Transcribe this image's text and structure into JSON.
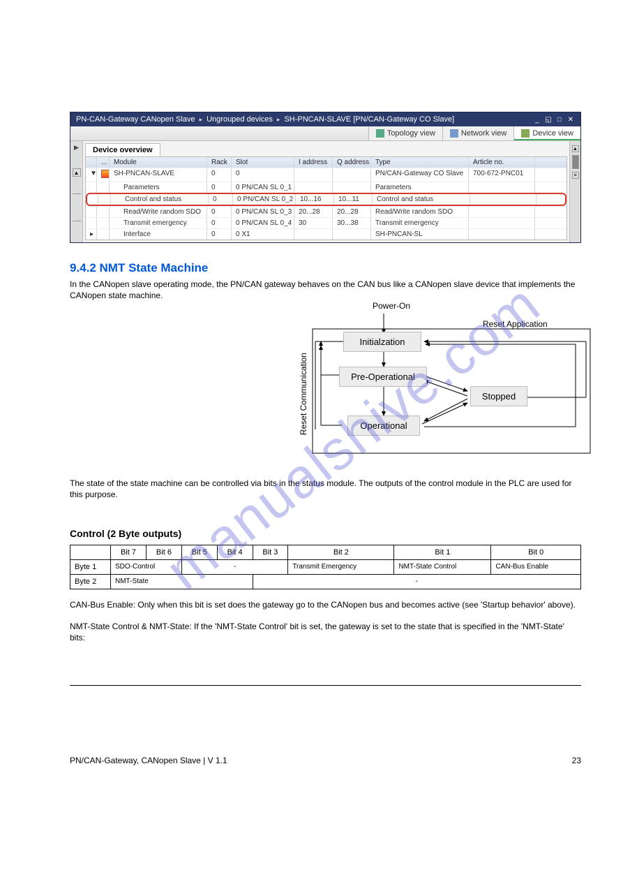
{
  "tia": {
    "breadcrumb": [
      "PN-CAN-Gateway CANopen Slave",
      "Ungrouped devices",
      "SH-PNCAN-SLAVE [PN/CAN-Gateway CO Slave]"
    ],
    "views": {
      "topology": "Topology view",
      "network": "Network view",
      "device": "Device view"
    },
    "overview_tab": "Device overview",
    "headers": {
      "module": "Module",
      "rack": "Rack",
      "slot": "Slot",
      "iaddr": "I address",
      "qaddr": "Q address",
      "type": "Type",
      "article": "Article no."
    },
    "rows": [
      {
        "indent": 0,
        "exp": "▼",
        "icon": true,
        "module": "SH-PNCAN-SLAVE",
        "rack": "0",
        "slot": "0",
        "iaddr": "",
        "qaddr": "",
        "type": "PN/CAN-Gateway CO Slave",
        "article": "700-672-PNC01",
        "hl": false
      },
      {
        "indent": 1,
        "exp": "",
        "icon": false,
        "module": "Parameters",
        "rack": "0",
        "slot": "0 PN/CAN SL 0_1",
        "iaddr": "",
        "qaddr": "",
        "type": "Parameters",
        "article": "",
        "hl": false
      },
      {
        "indent": 1,
        "exp": "",
        "icon": false,
        "module": "Control and status",
        "rack": "0",
        "slot": "0 PN/CAN SL 0_2",
        "iaddr": "10...16",
        "qaddr": "10...11",
        "type": "Control and status",
        "article": "",
        "hl": true
      },
      {
        "indent": 1,
        "exp": "",
        "icon": false,
        "module": "Read/Write random SDO",
        "rack": "0",
        "slot": "0 PN/CAN SL 0_3",
        "iaddr": "20...28",
        "qaddr": "20...28",
        "type": "Read/Write random SDO",
        "article": "",
        "hl": false
      },
      {
        "indent": 1,
        "exp": "",
        "icon": false,
        "module": "Transmit emergency",
        "rack": "0",
        "slot": "0 PN/CAN SL 0_4",
        "iaddr": "30",
        "qaddr": "30...38",
        "type": "Transmit emergency",
        "article": "",
        "hl": false
      },
      {
        "indent": 1,
        "exp": "▸",
        "icon": false,
        "module": "Interface",
        "rack": "0",
        "slot": "0 X1",
        "iaddr": "",
        "qaddr": "",
        "type": "SH-PNCAN-SL",
        "article": "",
        "hl": false
      }
    ]
  },
  "nmt": {
    "heading": "9.4.2 NMT State Machine",
    "para": "In the CANopen slave operating mode, the PN/CAN gateway behaves on the CAN bus like a CANopen slave device that implements the CANopen state machine.",
    "labels": {
      "poweron": "Power-On",
      "init": "Initialzation",
      "preop": "Pre-Operational",
      "op": "Operational",
      "stopped": "Stopped",
      "resetapp": "Reset Application",
      "resetcomm": "Reset Communication"
    },
    "note": "The state of the state machine can be controlled via bits in the status module. The outputs of the control module in the PLC are used for this purpose."
  },
  "ctl": {
    "heading": "Control (2 Byte outputs)",
    "headers": [
      "Bit 7",
      "Bit 6",
      "Bit 5",
      "Bit 4",
      "Bit 3",
      "Bit 2",
      "Bit 1",
      "Bit 0"
    ],
    "row1": {
      "byte": "Byte 1",
      "c7": "SDO-Control",
      "c543": "-",
      "c2": "Transmit Emergency",
      "c1": "NMT-State Control",
      "c0": "CAN-Bus Enable"
    },
    "row2": {
      "byte": "Byte 2",
      "c74": "NMT-State",
      "c30": "-"
    },
    "para1": "CAN-Bus Enable: Only when this bit is set does the gateway go to the CANopen bus and becomes active (see 'Startup behavior' above).",
    "para2": "NMT-State Control & NMT-State: If the 'NMT-State Control' bit is set, the gateway is set to the state that is specified in the 'NMT-State' bits:"
  },
  "footer": {
    "left": "PN/CAN-Gateway, CANopen Slave | V 1.1",
    "right": "23"
  }
}
